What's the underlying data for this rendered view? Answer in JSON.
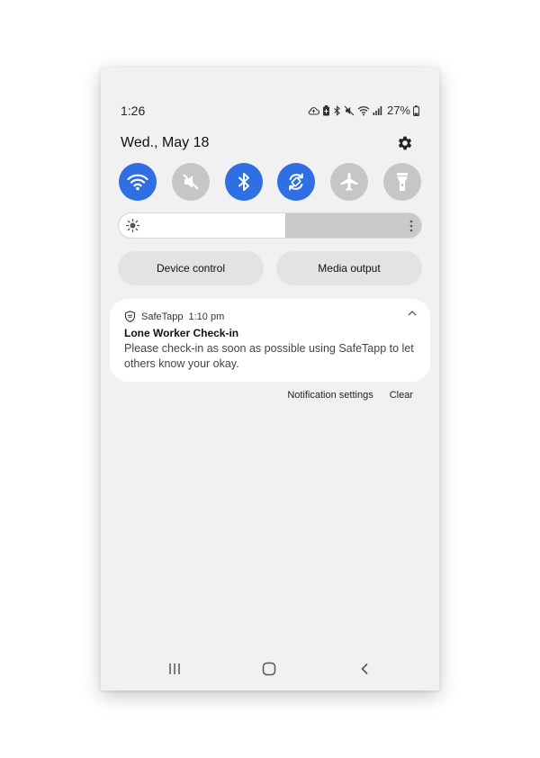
{
  "status_bar": {
    "time": "1:26",
    "battery": "27%",
    "icons": [
      "cloud-upload-icon",
      "battery-saver-icon",
      "bluetooth-icon",
      "mute-icon",
      "wifi-icon",
      "signal-icon",
      "battery-icon"
    ]
  },
  "header": {
    "date": "Wed., May 18",
    "settings_icon": "gear-icon"
  },
  "quick_settings": [
    {
      "name": "Wi-Fi",
      "icon": "wifi-icon",
      "state": "on"
    },
    {
      "name": "Mute",
      "icon": "mute-icon",
      "state": "off"
    },
    {
      "name": "Bluetooth",
      "icon": "bluetooth-icon",
      "state": "on"
    },
    {
      "name": "Auto rotate",
      "icon": "auto-rotate-icon",
      "state": "on"
    },
    {
      "name": "Airplane mode",
      "icon": "airplane-icon",
      "state": "off"
    },
    {
      "name": "Flashlight",
      "icon": "flashlight-icon",
      "state": "off"
    }
  ],
  "brightness": {
    "level": 0.55
  },
  "buttons": {
    "device_control": "Device control",
    "media_output": "Media output"
  },
  "notification": {
    "app": "SafeTapp",
    "time": "1:10 pm",
    "title": "Lone Worker Check-in",
    "body": "Please check-in as soon as possible using SafeTapp to let others know your okay."
  },
  "notification_actions": {
    "settings": "Notification settings",
    "clear": "Clear"
  },
  "nav": [
    "recents-icon",
    "home-icon",
    "back-icon"
  ],
  "colors": {
    "accent": "#2f6fe4",
    "tile_off": "#c6c6c6",
    "panel_bg": "#f1f1f1"
  }
}
